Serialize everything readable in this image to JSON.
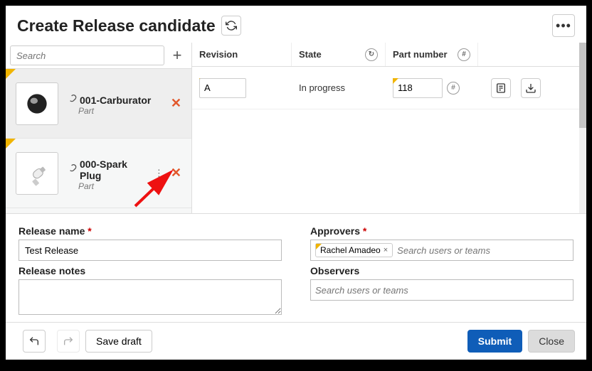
{
  "header": {
    "title": "Create Release candidate"
  },
  "search": {
    "placeholder": "Search"
  },
  "parts": [
    {
      "name": "001-Carburator",
      "type": "Part"
    },
    {
      "name": "000-Spark Plug",
      "type": "Part"
    }
  ],
  "columns": {
    "revision": "Revision",
    "state": "State",
    "partnum": "Part number"
  },
  "row": {
    "revision": "A",
    "state": "In progress",
    "partnum": "118"
  },
  "form": {
    "releaseNameLabel": "Release name",
    "releaseNameValue": "Test Release",
    "releaseNotesLabel": "Release notes",
    "approversLabel": "Approvers",
    "observersLabel": "Observers",
    "searchPlaceholder": "Search users or teams",
    "approverChip": "Rachel Amadeo"
  },
  "footer": {
    "saveDraft": "Save draft",
    "submit": "Submit",
    "close": "Close"
  }
}
